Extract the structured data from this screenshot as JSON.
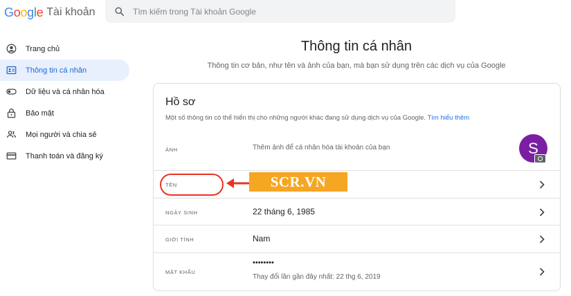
{
  "header": {
    "logo_letters": [
      "G",
      "o",
      "o",
      "g",
      "l",
      "e"
    ],
    "logo_colors": [
      "#4285F4",
      "#EA4335",
      "#FBBC05",
      "#4285F4",
      "#34A853",
      "#EA4335"
    ],
    "product_name": "Tài khoản",
    "search_placeholder": "Tìm kiếm trong Tài khoản Google"
  },
  "sidebar": {
    "items": [
      {
        "label": "Trang chủ",
        "icon": "home-icon"
      },
      {
        "label": "Thông tin cá nhân",
        "icon": "id-card-icon",
        "active": true
      },
      {
        "label": "Dữ liệu và cá nhân hóa",
        "icon": "toggle-icon"
      },
      {
        "label": "Bảo mật",
        "icon": "lock-icon"
      },
      {
        "label": "Mọi người và chia sẻ",
        "icon": "people-icon"
      },
      {
        "label": "Thanh toán và đăng ký",
        "icon": "credit-card-icon"
      }
    ]
  },
  "main": {
    "title": "Thông tin cá nhân",
    "subtitle": "Thông tin cơ bản, như tên và ảnh của bạn, mà bạn sử dụng trên các dịch vụ của Google"
  },
  "profile": {
    "title": "Hồ sơ",
    "description": "Một số thông tin có thể hiển thị cho những người khác đang sử dụng dịch vụ của Google.",
    "learn_more": "Tìm hiểu thêm",
    "photo": {
      "label": "Ảnh",
      "hint": "Thêm ảnh để cá nhân hóa tài khoản của bạn",
      "avatar_letter": "S",
      "avatar_color": "#7b1fa2"
    },
    "name": {
      "label": "Tên",
      "value": ""
    },
    "birthday": {
      "label": "Ngày sinh",
      "value": "22 tháng 6, 1985"
    },
    "gender": {
      "label": "Giới tính",
      "value": "Nam"
    },
    "password": {
      "label": "Mật khẩu",
      "value": "••••••••",
      "last_changed": "Thay đổi lần gần đây nhất: 22 thg 6, 2019"
    }
  },
  "annotation": {
    "watermark_text": "SCR.VN",
    "highlight_color": "#ea3323",
    "watermark_color": "#f5a623"
  }
}
